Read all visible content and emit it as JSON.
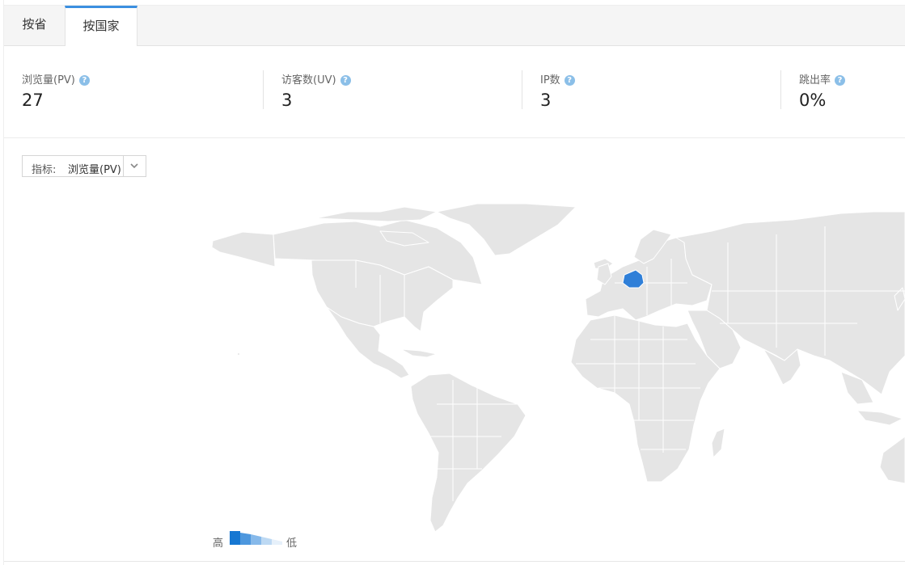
{
  "tabs": [
    {
      "label": "按省",
      "active": false
    },
    {
      "label": "按国家",
      "active": true
    }
  ],
  "stats": [
    {
      "label": "浏览量(PV)",
      "value": "27",
      "help": "?"
    },
    {
      "label": "访客数(UV)",
      "value": "3",
      "help": "?"
    },
    {
      "label": "IP数",
      "value": "3",
      "help": "?"
    },
    {
      "label": "跳出率",
      "value": "0%",
      "help": "?"
    }
  ],
  "metric_selector": {
    "prefix": "指标:",
    "value": "浏览量(PV)"
  },
  "map": {
    "highlighted_country": "Germany",
    "highlight_color": "#2f7fd8",
    "land_color": "#e5e5e5",
    "border_color": "#ffffff"
  },
  "legend": {
    "high_label": "高",
    "low_label": "低",
    "colors": [
      "#1677d2",
      "#4d97de",
      "#86b9ea",
      "#bdd9f3",
      "#e6f0fa"
    ]
  },
  "accent_color": "#3b8fe0"
}
